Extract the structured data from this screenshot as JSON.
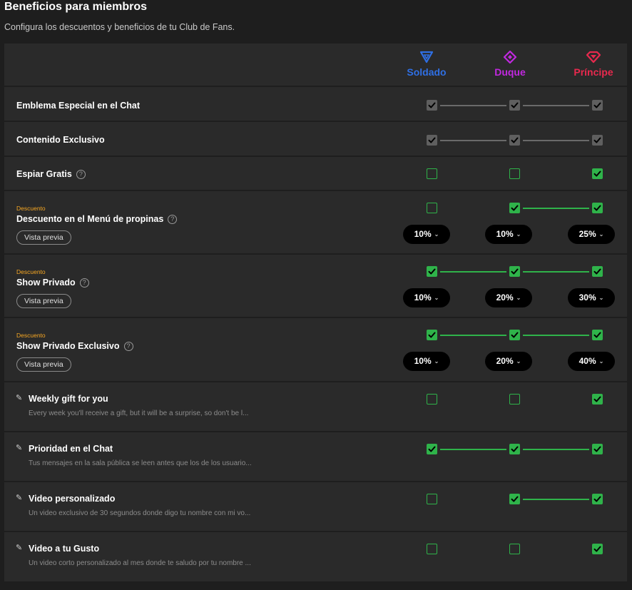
{
  "page": {
    "title": "Beneficios para miembros",
    "subtitle": "Configura los descuentos y beneficios de tu Club de Fans."
  },
  "tiers": [
    {
      "name": "Soldado",
      "color": "#2f6fe4",
      "icon": "triangle-down-icon"
    },
    {
      "name": "Duque",
      "color": "#c128e0",
      "icon": "diamond-icon"
    },
    {
      "name": "Príncipe",
      "color": "#e8294e",
      "icon": "gem-icon"
    }
  ],
  "common": {
    "preview_label": "Vista previa",
    "discount_tag": "Descuento",
    "help_glyph": "?",
    "chevron": "⌄"
  },
  "benefits": [
    {
      "label": "Emblema Especial en el Chat",
      "states": [
        "gray",
        "gray",
        "gray"
      ],
      "links": [
        "gray",
        "gray"
      ]
    },
    {
      "label": "Contenido Exclusivo",
      "states": [
        "gray",
        "gray",
        "gray"
      ],
      "links": [
        "gray",
        "gray"
      ]
    },
    {
      "label": "Espiar Gratis",
      "states": [
        "empty",
        "empty",
        "green"
      ],
      "links": [
        null,
        null
      ]
    },
    {
      "label": "Descuento en el Menú de propinas",
      "states": [
        "empty",
        "green",
        "green"
      ],
      "links": [
        null,
        "green"
      ],
      "discounts": [
        "10%",
        "10%",
        "25%"
      ]
    },
    {
      "label": "Show Privado",
      "states": [
        "green",
        "green",
        "green"
      ],
      "links": [
        "green",
        "green"
      ],
      "discounts": [
        "10%",
        "20%",
        "30%"
      ]
    },
    {
      "label": "Show Privado Exclusivo",
      "states": [
        "green",
        "green",
        "green"
      ],
      "links": [
        "green",
        "green"
      ],
      "discounts": [
        "10%",
        "20%",
        "40%"
      ]
    },
    {
      "label": "Weekly gift for you",
      "description": "Every week you'll receive a gift, but it will be a surprise, so don't be l...",
      "states": [
        "empty",
        "empty",
        "green"
      ],
      "links": [
        null,
        null
      ]
    },
    {
      "label": "Prioridad en el Chat",
      "description": "Tus mensajes en la sala pública se leen antes que los de los usuario...",
      "states": [
        "green",
        "green",
        "green"
      ],
      "links": [
        "green",
        "green"
      ]
    },
    {
      "label": "Video personalizado",
      "description": "Un video exclusivo de 30 segundos donde digo tu nombre con mi vo...",
      "states": [
        "empty",
        "green",
        "green"
      ],
      "links": [
        null,
        "green"
      ]
    },
    {
      "label": "Video a tu Gusto",
      "description": "Un video corto personalizado al mes donde te saludo por tu nombre ...",
      "states": [
        "empty",
        "empty",
        "green"
      ],
      "links": [
        null,
        null
      ]
    }
  ]
}
